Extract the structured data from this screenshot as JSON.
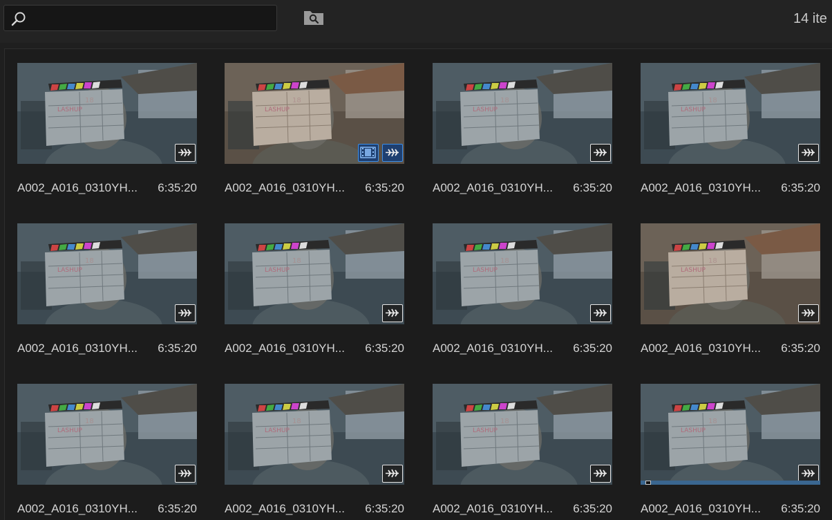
{
  "search": {
    "value": "",
    "placeholder": ""
  },
  "toolbar": {
    "new_bin_icon": "folder-search-icon"
  },
  "item_count_text": "14 ite",
  "colors": {
    "background": "#1f1f1f",
    "selected_badge": "#3b8ee8",
    "scrubber": "#3a6690"
  },
  "clips": [
    {
      "name": "A002_A016_0310YH...",
      "duration": "6:35:20",
      "badges": [
        "audio"
      ],
      "tint": "cool"
    },
    {
      "name": "A002_A016_0310YH...",
      "duration": "6:35:20",
      "badges": [
        "video",
        "audio"
      ],
      "tint": "warm"
    },
    {
      "name": "A002_A016_0310YH...",
      "duration": "6:35:20",
      "badges": [
        "audio"
      ],
      "tint": "cool"
    },
    {
      "name": "A002_A016_0310YH...",
      "duration": "6:35:20",
      "badges": [
        "audio"
      ],
      "tint": "cool"
    },
    {
      "name": "A002_A016_0310YH...",
      "duration": "6:35:20",
      "badges": [
        "audio"
      ],
      "tint": "cool"
    },
    {
      "name": "A002_A016_0310YH...",
      "duration": "6:35:20",
      "badges": [
        "audio"
      ],
      "tint": "cool"
    },
    {
      "name": "A002_A016_0310YH...",
      "duration": "6:35:20",
      "badges": [
        "audio"
      ],
      "tint": "cool"
    },
    {
      "name": "A002_A016_0310YH...",
      "duration": "6:35:20",
      "badges": [
        "audio"
      ],
      "tint": "warm"
    },
    {
      "name": "A002_A016_0310YH...",
      "duration": "6:35:20",
      "badges": [
        "audio"
      ],
      "tint": "cool"
    },
    {
      "name": "A002_A016_0310YH...",
      "duration": "6:35:20",
      "badges": [
        "audio"
      ],
      "tint": "cool"
    },
    {
      "name": "A002_A016_0310YH...",
      "duration": "6:35:20",
      "badges": [
        "audio"
      ],
      "tint": "cool"
    },
    {
      "name": "A002_A016_0310YH...",
      "duration": "6:35:20",
      "badges": [
        "audio"
      ],
      "tint": "cool",
      "scrubber": true,
      "scrub_progress": 0.02
    }
  ]
}
